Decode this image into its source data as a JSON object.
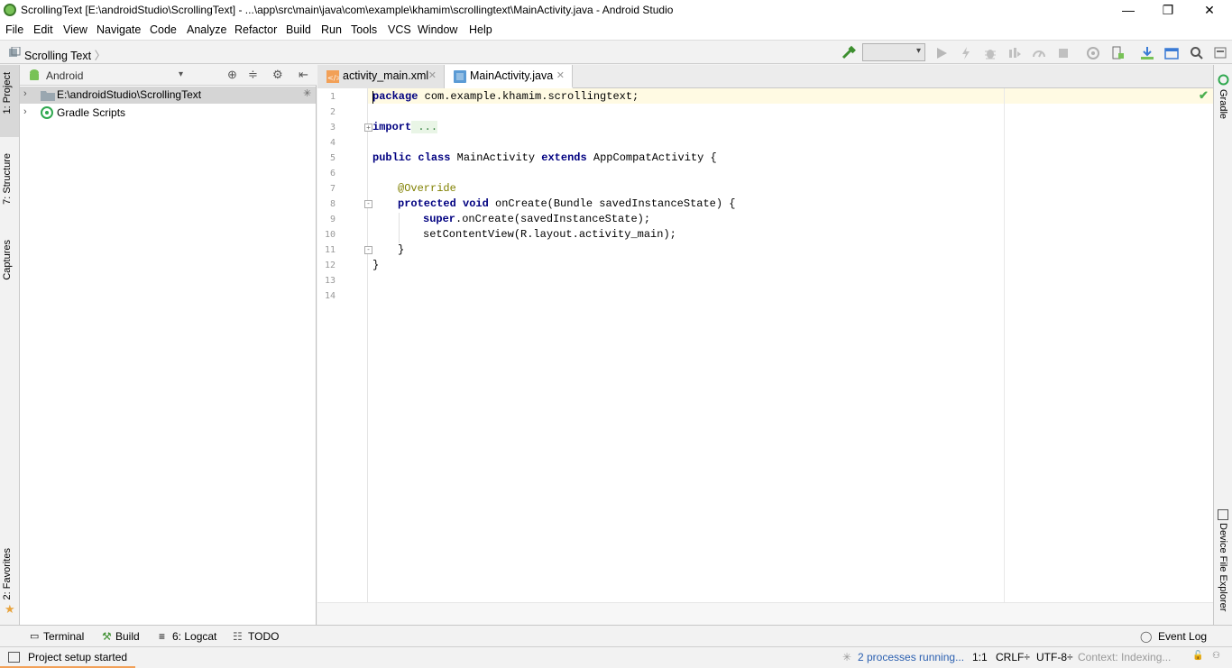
{
  "window": {
    "title": "ScrollingText [E:\\androidStudio\\ScrollingText] - ...\\app\\src\\main\\java\\com\\example\\khamim\\scrollingtext\\MainActivity.java - Android Studio",
    "minimize": "—",
    "maximize": "❐",
    "close": "✕"
  },
  "menu": [
    "File",
    "Edit",
    "View",
    "Navigate",
    "Code",
    "Analyze",
    "Refactor",
    "Build",
    "Run",
    "Tools",
    "VCS",
    "Window",
    "Help"
  ],
  "breadcrumb": "Scrolling Text",
  "left_tabs": {
    "project": "1: Project",
    "structure": "7: Structure",
    "captures": "Captures",
    "favorites": "2: Favorites"
  },
  "right_tabs": {
    "gradle": "Gradle",
    "device_explorer": "Device File Explorer"
  },
  "project": {
    "view_mode": "Android",
    "tree": [
      {
        "label": "E:\\androidStudio\\ScrollingText",
        "icon": "folder-icon"
      },
      {
        "label": "Gradle Scripts",
        "icon": "gradle-icon"
      }
    ]
  },
  "editor": {
    "tabs": [
      {
        "label": "activity_main.xml",
        "active": false
      },
      {
        "label": "MainActivity.java",
        "active": true
      }
    ],
    "line_numbers": [
      "1",
      "2",
      "3",
      "4",
      "5",
      "6",
      "7",
      "8",
      "9",
      "10",
      "11",
      "12",
      "13",
      "14"
    ],
    "code": {
      "l1_kw": "package",
      "l1_rest": " com.example.khamim.scrollingtext;",
      "l3_kw": "import",
      "l3_rest": " ...",
      "l6_kw1": "public",
      "l6_kw2": "class",
      "l6_name": " MainActivity ",
      "l6_kw3": "extends",
      "l6_rest": " AppCompatActivity {",
      "l8": "@Override",
      "l9_kw1": "protected",
      "l9_kw2": "void",
      "l9_rest": " onCreate(Bundle savedInstanceState) {",
      "l10_kw": "super",
      "l10_rest": ".onCreate(savedInstanceState);",
      "l11": "setContentView(R.layout.activity_main);",
      "l12": "}",
      "l13": "}"
    }
  },
  "bottom_tools": {
    "terminal": "Terminal",
    "build": "Build",
    "logcat": "6: Logcat",
    "todo": "TODO",
    "event_log": "Event Log"
  },
  "status": {
    "message": "Project setup started",
    "processes": "2 processes running...",
    "position": "1:1",
    "line_sep": "CRLF÷",
    "encoding": "UTF-8÷",
    "context": "Context: Indexing..."
  },
  "colors": {
    "keyword": "#000080",
    "annotation": "#808000",
    "accent": "#4a8ad9",
    "android_green": "#78c257"
  }
}
